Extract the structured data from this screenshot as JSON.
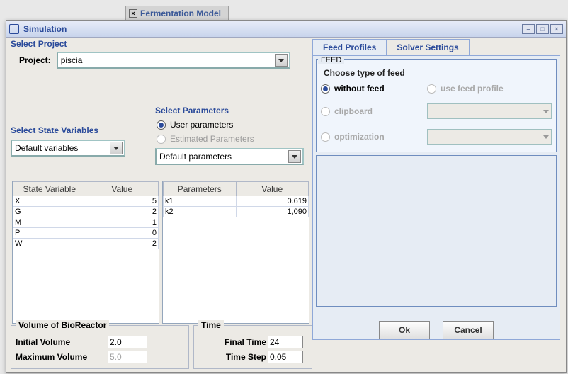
{
  "bg_tab": {
    "label": "Fermentation Model"
  },
  "window": {
    "title": "Simulation",
    "buttons": {
      "min": "–",
      "max": "□",
      "close": "×"
    }
  },
  "project": {
    "section_label": "Select Project",
    "field_label": "Project:",
    "value": "piscia"
  },
  "state_variables": {
    "section_label": "Select State Variables",
    "value": "Default variables",
    "table_headers": [
      "State Variable",
      "Value"
    ],
    "rows": [
      {
        "name": "X",
        "value": "5"
      },
      {
        "name": "G",
        "value": "2"
      },
      {
        "name": "M",
        "value": "1"
      },
      {
        "name": "P",
        "value": "0"
      },
      {
        "name": "W",
        "value": "2"
      }
    ]
  },
  "parameters": {
    "section_label": "Select Parameters",
    "radio_user": "User parameters",
    "radio_estimated": "Estimated Parameters",
    "value": "Default parameters",
    "table_headers": [
      "Parameters",
      "Value"
    ],
    "rows": [
      {
        "name": "k1",
        "value": "0.619"
      },
      {
        "name": "k2",
        "value": "1,090"
      }
    ]
  },
  "volume": {
    "legend": "Volume of BioReactor",
    "initial_label": "Initial Volume",
    "initial_value": "2.0",
    "max_label": "Maximum Volume",
    "max_value": "5.0"
  },
  "time": {
    "legend": "Time",
    "final_label": "Final Time",
    "final_value": "24",
    "step_label": "Time Step",
    "step_value": "0.05"
  },
  "tabs": {
    "feed": "Feed Profiles",
    "solver": "Solver Settings"
  },
  "feed": {
    "fieldset_legend": "FEED",
    "choose_label": "Choose type of feed",
    "opts": {
      "without": "without feed",
      "use_profile": "use feed profile",
      "clipboard": "clipboard",
      "optimization": "optimization"
    }
  },
  "buttons": {
    "ok": "Ok",
    "cancel": "Cancel"
  }
}
